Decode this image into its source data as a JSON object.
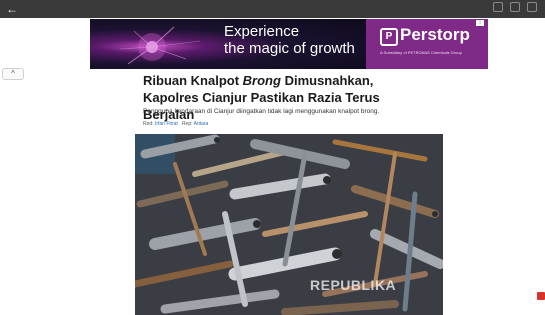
{
  "toolbar": {
    "back_icon": "back-arrow-icon"
  },
  "ad": {
    "headline_line1": "Experience",
    "headline_line2": "the magic of growth",
    "brand": "Perstorp",
    "tagline": "A Subsidiary of PETRONAS Chemicals Group",
    "colors": {
      "brand_bg": "#7e2a86"
    }
  },
  "article": {
    "title_part1": "Ribuan Knalpot ",
    "title_italic": "Brong",
    "title_part2": " Dimusnahkan, Kapolres Cianjur Pastikan Razia Terus Berjalan",
    "subtitle": "Pengguna kendaraan di Cianjur diingatkan tidak lagi menggunakan knalpot brong.",
    "red_label": "Red:",
    "red_name": "Irfan Fitrat",
    "rep_label": "Rep:",
    "rep_name": "Antara"
  },
  "photo": {
    "watermark": "REPUBLIKA"
  }
}
